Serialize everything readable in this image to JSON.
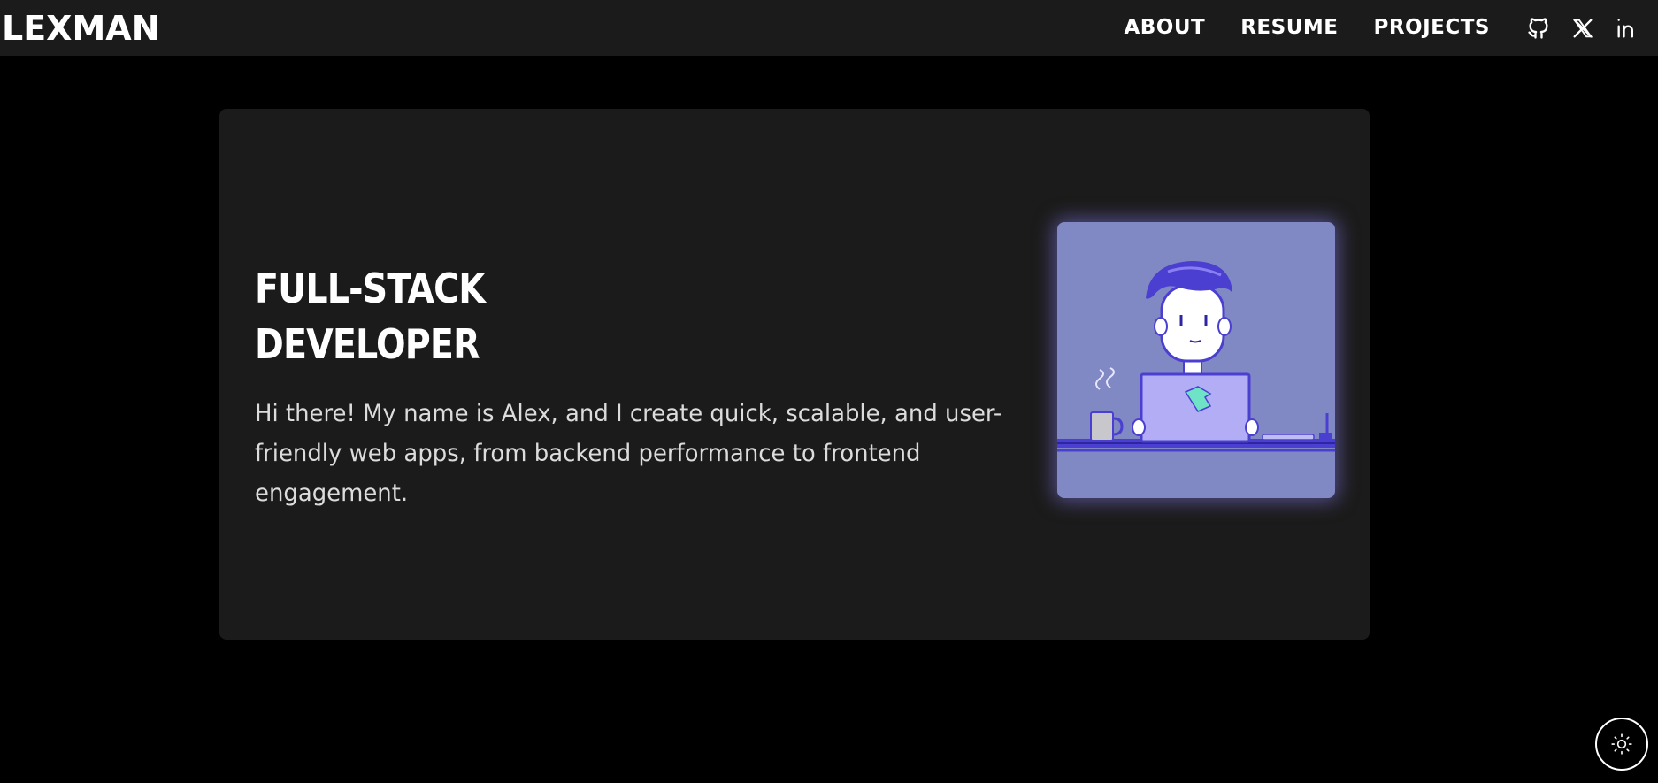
{
  "brand": {
    "logo": "LEXMAN"
  },
  "nav": {
    "links": [
      {
        "label": "ABOUT"
      },
      {
        "label": "RESUME"
      },
      {
        "label": "PROJECTS"
      }
    ],
    "social": [
      "github-icon",
      "x-twitter-icon",
      "linkedin-icon"
    ]
  },
  "hero": {
    "title_line1": "FULL-STACK",
    "title_line2": "DEVELOPER",
    "description": "Hi there! My name is Alex, and I create quick, scalable, and user-friendly web apps, from backend performance to frontend engagement.",
    "illustration": "developer-at-laptop-illustration"
  },
  "theme_toggle": {
    "icon": "sun-icon"
  },
  "colors": {
    "background": "#000000",
    "surface": "#1b1b1b",
    "illustration_bg": "#8189c4",
    "accent": "#4a3fd0"
  }
}
